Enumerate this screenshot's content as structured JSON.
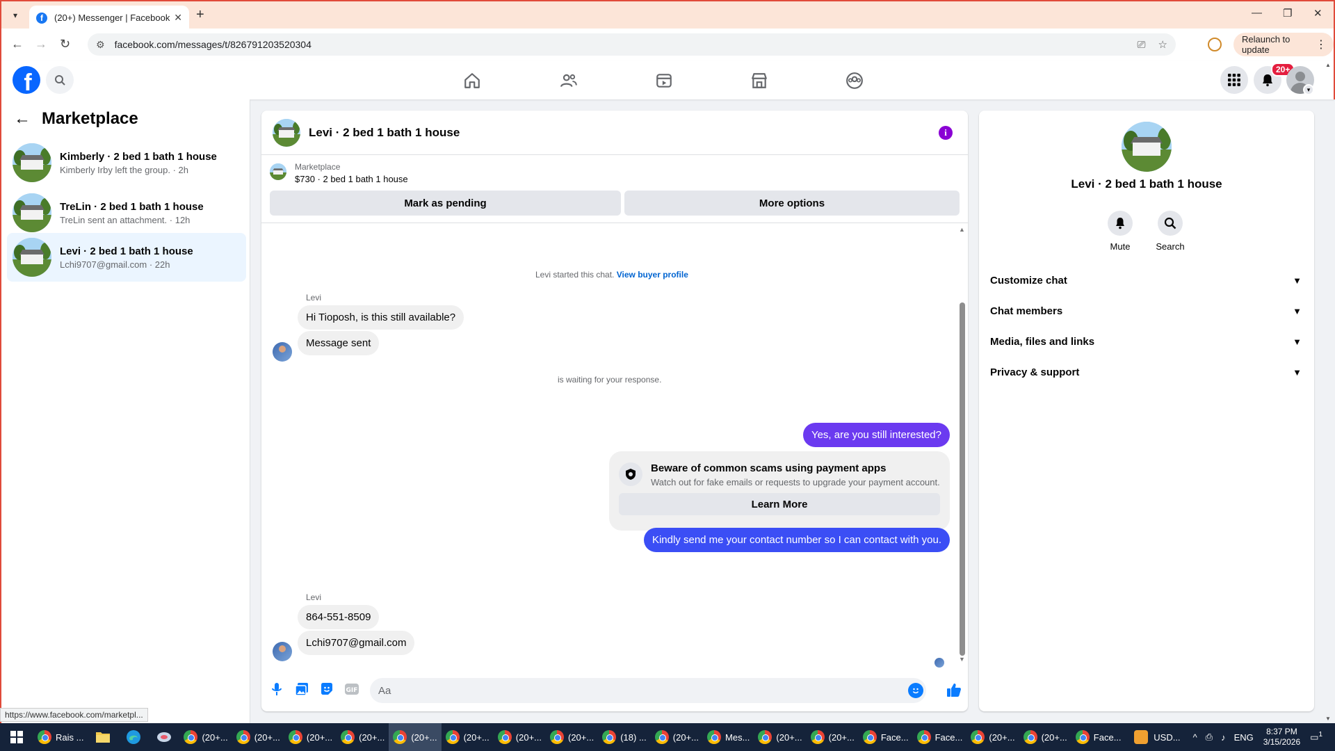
{
  "browser": {
    "tab_title": "(20+) Messenger | Facebook",
    "url": "facebook.com/messages/t/826791203520304",
    "relaunch_label": "Relaunch to update",
    "status_url": "https://www.facebook.com/marketpl..."
  },
  "fb": {
    "notif_count": "20+",
    "brand_color": "#0866ff"
  },
  "sidebar": {
    "title": "Marketplace",
    "conversations": [
      {
        "name": "Kimberly · 2 bed 1 bath 1 house",
        "sub": "Kimberly Irby left the group. · 2h",
        "active": false
      },
      {
        "name": "TreLin · 2 bed 1 bath 1 house",
        "sub": "TreLin sent an attachment. · 12h",
        "active": false
      },
      {
        "name": "Levi · 2 bed 1 bath 1 house",
        "sub": "Lchi9707@gmail.com · 22h",
        "active": true
      }
    ]
  },
  "chat": {
    "title": "Levi · 2 bed 1 bath 1 house",
    "marketplace_label": "Marketplace",
    "listing": "$730 · 2 bed 1 bath 1 house",
    "mark_pending": "Mark as pending",
    "more_options": "More options",
    "started_text": "Levi started this chat.",
    "view_buyer_profile": "View buyer profile",
    "sender_name": "Levi",
    "msg_1": "Hi Tioposh, is this still available?",
    "msg_2": "Message sent",
    "waiting_text": "is waiting for your response.",
    "out_1": "Yes, are you still interested?",
    "scam_title": "Beware of common scams using payment apps",
    "scam_sub": "Watch out for fake emails or requests to upgrade your payment account.",
    "learn_more": "Learn More",
    "out_2": "Kindly send me your contact number so I can contact with you.",
    "msg_3": "864-551-8509",
    "msg_4": "Lchi9707@gmail.com",
    "input_placeholder": "Aa",
    "colors": {
      "outgoing_purple": "#6b3af0",
      "outgoing_blue": "#3b4ef5"
    }
  },
  "rpanel": {
    "title": "Levi · 2 bed 1 bath 1 house",
    "mute": "Mute",
    "search": "Search",
    "rows": [
      "Customize chat",
      "Chat members",
      "Media, files and links",
      "Privacy & support"
    ]
  },
  "taskbar": {
    "items": [
      "Rais ...",
      "(20+...",
      "(20+...",
      "(20+...",
      "(20+...",
      "(20+...",
      "(20+...",
      "(20+...",
      "(20+...",
      "(18) ...",
      "(20+...",
      "Mes...",
      "(20+...",
      "(20+...",
      "Face...",
      "Face...",
      "(20+...",
      "(20+...",
      "Face..."
    ],
    "tray_text": "USD...",
    "lang": "ENG",
    "time": "8:37 PM",
    "date": "3/15/2026",
    "notif_count": "1"
  }
}
